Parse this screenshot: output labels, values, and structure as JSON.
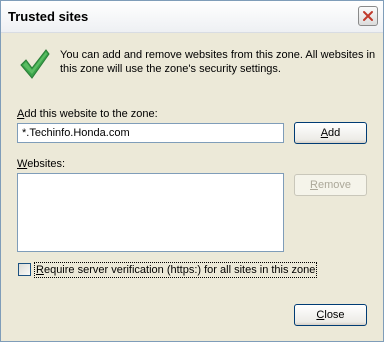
{
  "dialog": {
    "title": "Trusted sites",
    "info": "You can add and remove websites from this zone. All websites in this zone will use the zone's security settings.",
    "add_label_first": "A",
    "add_label_rest": "dd this website to the zone:",
    "add_input_value": "*.Techinfo.Honda.com",
    "add_button_first": "A",
    "add_button_rest": "dd",
    "websites_label_first": "W",
    "websites_label_rest": "ebsites:",
    "remove_button_first": "R",
    "remove_button_rest": "emove",
    "https_label_first": "R",
    "https_label_rest": "equire server verification (https:) for all sites in this zone",
    "https_checked": false,
    "close_button_first": "C",
    "close_button_rest": "lose"
  },
  "icons": {
    "status": "checkmark-icon",
    "close": "close-icon"
  },
  "colors": {
    "dialog_bg": "#ece9d8",
    "check_green": "#3aa34a",
    "close_x": "#c0392b"
  }
}
